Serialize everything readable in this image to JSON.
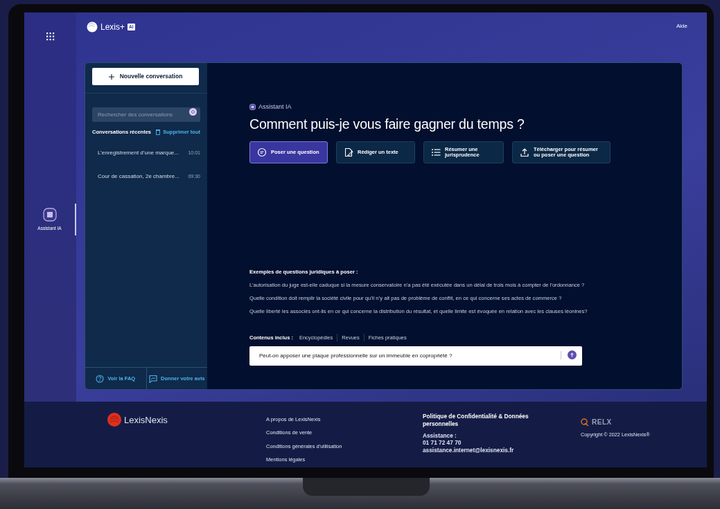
{
  "rail": {
    "items": [
      {
        "label": "Assistant IA",
        "selected": true
      }
    ]
  },
  "header": {
    "logo_text": "Lexis+",
    "logo_badge": "AI",
    "help": "Aide"
  },
  "sidebar": {
    "new_button": "Nouvelle conversation",
    "search": {
      "placeholder": "Rechercher des conversations"
    },
    "recent_title": "Conversations récentes",
    "clear_all": "Supprimer tout",
    "conversations": [
      {
        "title": "L’enregistrement d’une marque...",
        "time": "10:01"
      },
      {
        "title": "Cour de cassation, 2e chambre...",
        "time": "09:30"
      }
    ],
    "footer_links": [
      {
        "label": "Voir la FAQ",
        "kind": "help"
      },
      {
        "label": "Donner votre avis",
        "kind": "feedback"
      }
    ]
  },
  "main": {
    "eyebrow": "Assistant IA",
    "heading": "Comment puis-je vous faire gagner du temps ?",
    "actions": [
      {
        "label": "Poser une question",
        "kind": "chat",
        "selected": true
      },
      {
        "label": "Rédiger un texte",
        "kind": "edit",
        "selected": false
      },
      {
        "label": "Résumer une jurisprudence",
        "kind": "list",
        "selected": false
      },
      {
        "label": "Télécharger pour résumer ou poser une question",
        "kind": "upload",
        "selected": false
      }
    ],
    "examples_title": "Exemples de questions juridiques à poser :",
    "examples": [
      "L’autorisation du juge est-elle caduque si la mesure conservatoire n’a pas été exécutée dans un délai de trois mois à compter de l’ordonnance ?",
      "Quelle condition doit remplir la société civile pour qu’il n’y ait pas de problème de conflit, en ce qui concerne ses actes de commerce ?",
      "Quelle liberté les associés ont-ils en ce qui concerne la distribution du résultat, et quelle limite est évoquée en relation avec les clauses léonines?"
    ],
    "sources_label": "Contenus inclus :",
    "sources": [
      "Encyclopédies",
      "Revues",
      "Fiches pratiques"
    ],
    "query": {
      "value": "Peut-on apposer une plaque professionnelle sur un immeuble en copropriété ?"
    }
  },
  "footer": {
    "brand": "LexisNexis",
    "links": [
      "A propos de LexisNexis",
      "Conditions de vente",
      "Conditions générales d'utilisation",
      "Mentions légales"
    ],
    "privacy": "Politique de Confidentialité & Données personnelles",
    "assistance_label": "Assistance :",
    "phone": "01 71 72 47 70",
    "email": "assistance.internet@lexisnexis.fr",
    "relx": "RELX",
    "copyright": "Copyright © 2022 LexisNexis®"
  }
}
